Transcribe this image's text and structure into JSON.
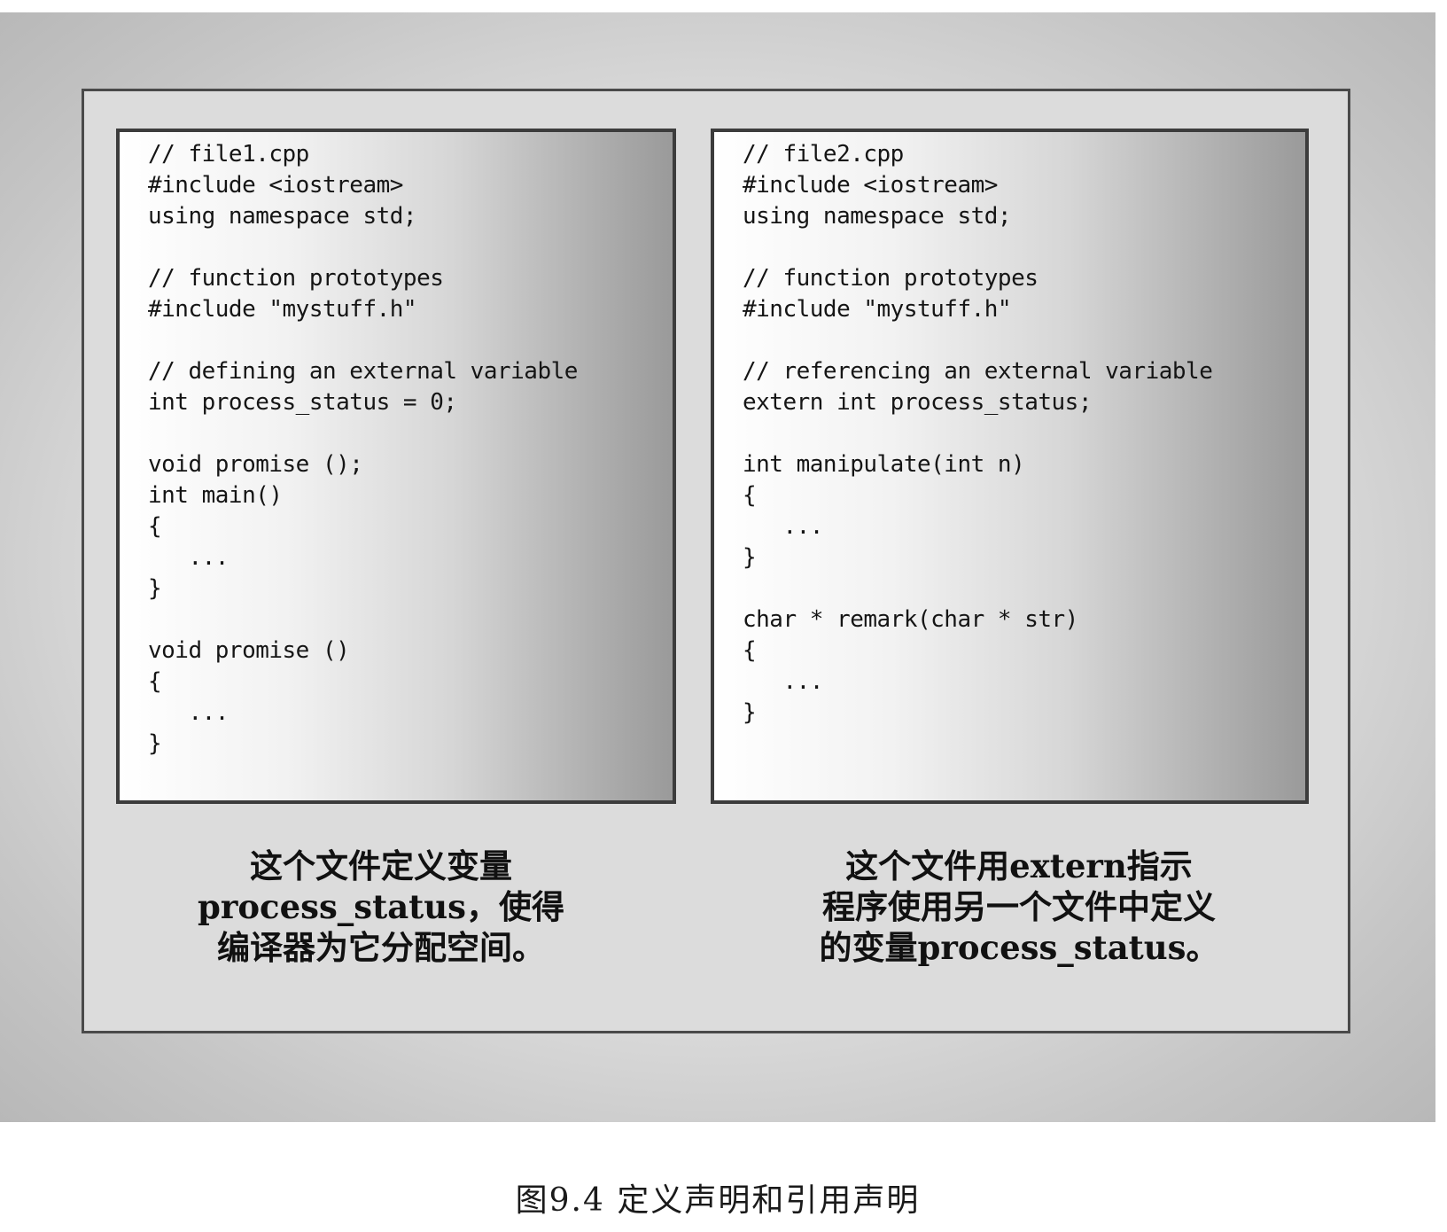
{
  "left_panel": {
    "code": [
      "// file1.cpp",
      "#include <iostream>",
      "using namespace std;",
      "",
      "// function prototypes",
      "#include \"mystuff.h\"",
      "",
      "// defining an external variable",
      "int process_status = 0;",
      "",
      "void promise ();",
      "int main()",
      "{",
      "   ...",
      "}",
      "",
      "void promise ()",
      "{",
      "   ...",
      "}"
    ],
    "caption": [
      "这个文件定义变量",
      "process_status，使得",
      "编译器为它分配空间。"
    ]
  },
  "right_panel": {
    "code": [
      "// file2.cpp",
      "#include <iostream>",
      "using namespace std;",
      "",
      "// function prototypes",
      "#include \"mystuff.h\"",
      "",
      "// referencing an external variable",
      "extern int process_status;",
      "",
      "int manipulate(int n)",
      "{",
      "   ...",
      "}",
      "",
      "char * remark(char * str)",
      "{",
      "   ...",
      "}"
    ],
    "caption": [
      "这个文件用extern指示",
      "程序使用另一个文件中定义",
      "的变量process_status。"
    ]
  },
  "figure_title": "图9.4 定义声明和引用声明"
}
